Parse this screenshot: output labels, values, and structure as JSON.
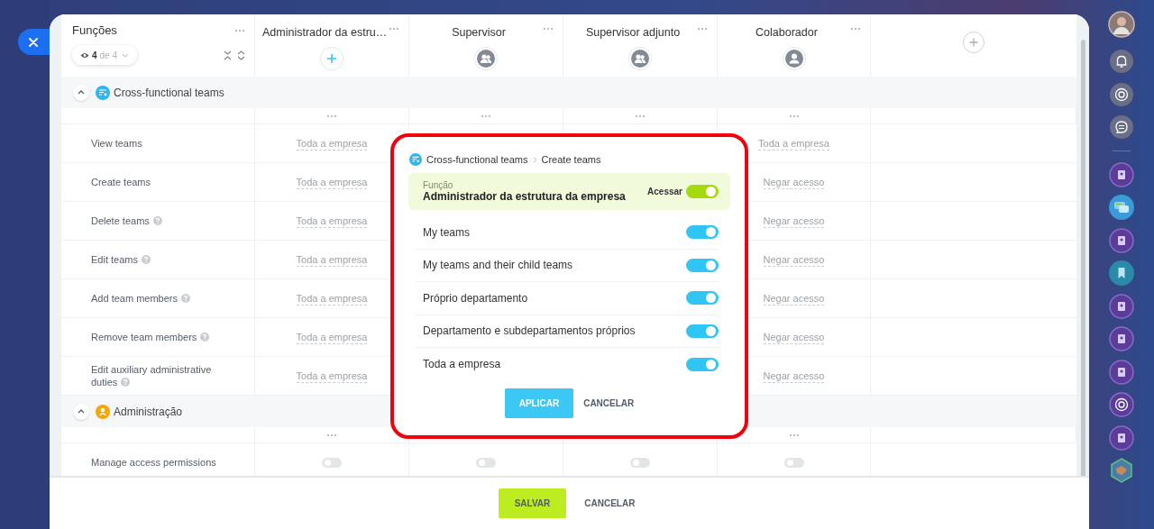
{
  "table": {
    "first_column": {
      "title": "Funções",
      "filter": {
        "shown": "4",
        "total": "de 4"
      }
    },
    "columns": [
      {
        "name": "Administrador da estru…",
        "kind": "add"
      },
      {
        "name": "Supervisor",
        "kind": "group"
      },
      {
        "name": "Supervisor adjunto",
        "kind": "group"
      },
      {
        "name": "Colaborador",
        "kind": "person"
      }
    ],
    "sections": [
      {
        "title": "Cross-functional teams",
        "kind": "teams",
        "expanded": true,
        "rows": [
          {
            "label": "View teams",
            "help": false,
            "kind": "scope",
            "cells": [
              {
                "text": "Toda a empresa"
              },
              {
                "text": "Toda a empresa"
              }
            ]
          },
          {
            "label": "Create teams",
            "help": false,
            "kind": "scope",
            "cells": [
              {
                "text": "Toda a empresa"
              },
              {
                "text": "Negar acesso"
              }
            ]
          },
          {
            "label": "Delete teams",
            "help": true,
            "kind": "scope",
            "cells": [
              {
                "text": "Toda a empresa"
              },
              {
                "text": "Negar acesso"
              }
            ]
          },
          {
            "label": "Edit teams",
            "help": true,
            "kind": "scope",
            "cells": [
              {
                "text": "Toda a empresa"
              },
              {
                "text": "Negar acesso"
              }
            ]
          },
          {
            "label": "Add team members",
            "help": true,
            "kind": "scope",
            "cells": [
              {
                "text": "Toda a empresa"
              },
              {
                "text": "Negar acesso"
              }
            ]
          },
          {
            "label": "Remove team members",
            "help": true,
            "kind": "scope",
            "cells": [
              {
                "text": "Toda a empresa"
              },
              {
                "text": "Negar acesso"
              }
            ]
          },
          {
            "label": "Edit auxiliary administrative duties",
            "help": true,
            "kind": "scope",
            "cells": [
              {
                "text": "Toda a empresa"
              },
              {
                "text": "Negar acesso"
              }
            ]
          }
        ]
      },
      {
        "title": "Administração",
        "kind": "admin",
        "expanded": true,
        "rows": [
          {
            "label": "Manage access permissions",
            "help": false,
            "kind": "toggle",
            "toggles": [
              {
                "on": false
              },
              {
                "on": false
              },
              {
                "on": false
              },
              {
                "on": false
              }
            ]
          }
        ]
      }
    ]
  },
  "popup": {
    "breadcrumb": [
      "Cross-functional teams",
      "Create teams"
    ],
    "role_label": "Função",
    "role": "Administrador da estrutura da empresa",
    "access_label": "Acessar",
    "access_on": true,
    "options": [
      {
        "label": "My teams",
        "on": true
      },
      {
        "label": "My teams and their child teams",
        "on": true
      },
      {
        "label": "Próprio departamento",
        "on": true
      },
      {
        "label": "Departamento e subdepartamentos próprios",
        "on": true
      },
      {
        "label": "Toda a empresa",
        "on": true
      }
    ],
    "buttons": [
      {
        "label": "APLICAR",
        "kind": "primary"
      },
      {
        "label": "CANCELAR",
        "kind": "link"
      }
    ]
  },
  "footer": {
    "buttons": [
      {
        "label": "SALVAR",
        "kind": "primary"
      },
      {
        "label": "CANCELAR",
        "kind": "link"
      }
    ]
  }
}
